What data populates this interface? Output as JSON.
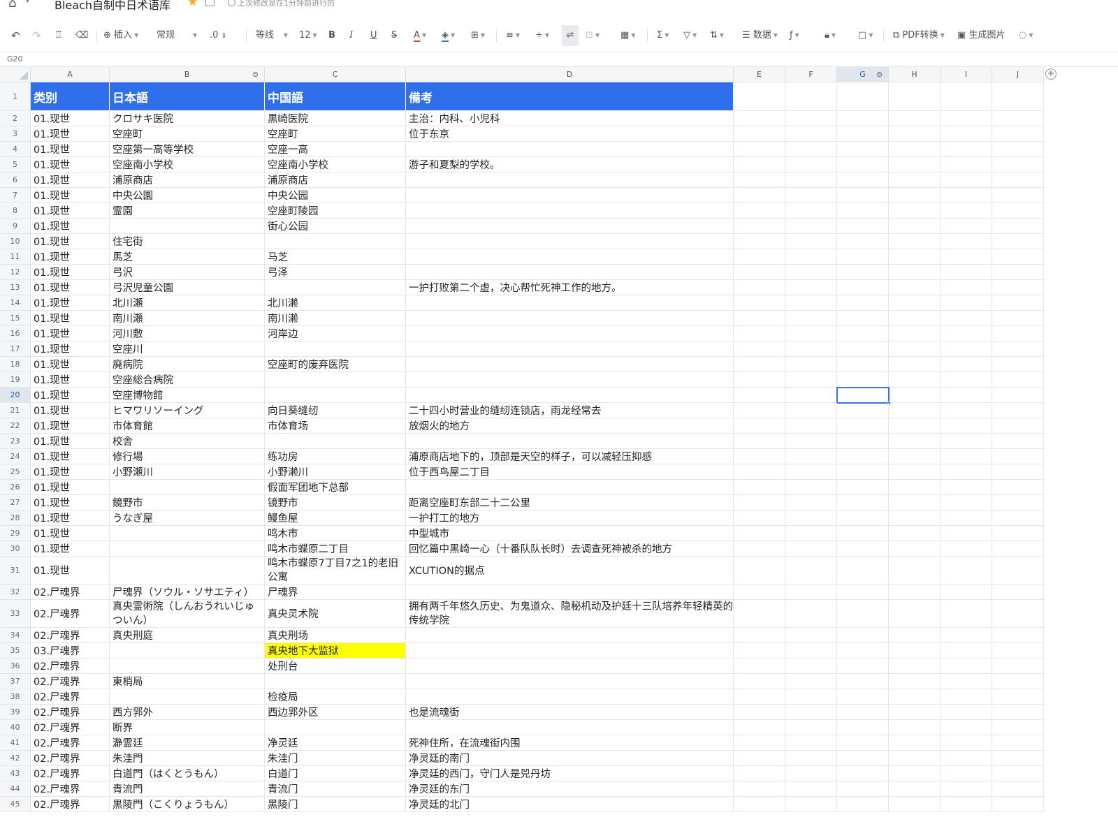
{
  "title_bar": {
    "doc_title": "Bleach自制中日术语库",
    "saved_status": "上次修改是在1分钟前进行的"
  },
  "toolbar": {
    "insert_label": "插入",
    "format_value": "常规",
    "decimal_label": ".0",
    "font_name": "等线",
    "font_size": "12",
    "data_label": "数据",
    "pdf_label": "PDF转换",
    "image_label": "生成图片"
  },
  "formula_bar": {
    "cell_ref": "G20"
  },
  "columns": [
    "A",
    "B",
    "C",
    "D",
    "E",
    "F",
    "G",
    "H",
    "I",
    "J"
  ],
  "selected_column": "G",
  "selected_row": "20",
  "header_row": {
    "num": "1",
    "a": "类别",
    "b": "日本語",
    "c": "中国語",
    "d": "備考"
  },
  "rows": [
    {
      "num": "2",
      "a": "01.现世",
      "b": "クロサキ医院",
      "c": "黒崎医院",
      "d": "主治：内科、小児科"
    },
    {
      "num": "3",
      "a": "01.现世",
      "b": "空座町",
      "c": "空座町",
      "d": "位于东京"
    },
    {
      "num": "4",
      "a": "01.现世",
      "b": "空座第一高等学校",
      "c": "空座一高",
      "d": ""
    },
    {
      "num": "5",
      "a": "01.现世",
      "b": "空座南小学校",
      "c": "空座南小学校",
      "d": "游子和夏梨的学校。"
    },
    {
      "num": "6",
      "a": "01.现世",
      "b": "浦原商店",
      "c": "浦原商店",
      "d": ""
    },
    {
      "num": "7",
      "a": "01.现世",
      "b": "中央公園",
      "c": "中央公园",
      "d": ""
    },
    {
      "num": "8",
      "a": "01.现世",
      "b": "霊園",
      "c": "空座町陵园",
      "d": ""
    },
    {
      "num": "9",
      "a": "01.现世",
      "b": "",
      "c": "街心公园",
      "d": ""
    },
    {
      "num": "10",
      "a": "01.现世",
      "b": "住宅街",
      "c": "",
      "d": ""
    },
    {
      "num": "11",
      "a": "01.现世",
      "b": "馬芝",
      "c": "马芝",
      "d": ""
    },
    {
      "num": "12",
      "a": "01.现世",
      "b": "弓沢",
      "c": "弓泽",
      "d": ""
    },
    {
      "num": "13",
      "a": "01.现世",
      "b": "弓沢児童公園",
      "c": "",
      "d": "一护打败第二个虚，决心帮忙死神工作的地方。"
    },
    {
      "num": "14",
      "a": "01.现世",
      "b": "北川瀬",
      "c": "北川濑",
      "d": ""
    },
    {
      "num": "15",
      "a": "01.现世",
      "b": "南川瀬",
      "c": "南川濑",
      "d": ""
    },
    {
      "num": "16",
      "a": "01.现世",
      "b": "河川敷",
      "c": "河岸边",
      "d": ""
    },
    {
      "num": "17",
      "a": "01.现世",
      "b": "空座川",
      "c": "",
      "d": ""
    },
    {
      "num": "18",
      "a": "01.现世",
      "b": "廃病院",
      "c": "空座町的废弃医院",
      "d": ""
    },
    {
      "num": "19",
      "a": "01.现世",
      "b": "空座総合病院",
      "c": "",
      "d": ""
    },
    {
      "num": "20",
      "a": "01.现世",
      "b": "空座博物館",
      "c": "",
      "d": ""
    },
    {
      "num": "21",
      "a": "01.现世",
      "b": "ヒマワリソーイング",
      "c": "向日葵缝纫",
      "d": "二十四小时营业的缝纫连锁店，雨龙经常去"
    },
    {
      "num": "22",
      "a": "01.现世",
      "b": "市体育館",
      "c": "市体育场",
      "d": "放烟火的地方"
    },
    {
      "num": "23",
      "a": "01.现世",
      "b": "校舎",
      "c": "",
      "d": ""
    },
    {
      "num": "24",
      "a": "01.现世",
      "b": "修行場",
      "c": "练功房",
      "d": "浦原商店地下的，顶部是天空的样子，可以减轻压抑感"
    },
    {
      "num": "25",
      "a": "01.现世",
      "b": "小野瀬川",
      "c": "小野濑川",
      "d": "位于西鸟屋二丁目"
    },
    {
      "num": "26",
      "a": "01.现世",
      "b": "",
      "c": "假面军团地下总部",
      "d": ""
    },
    {
      "num": "27",
      "a": "01.现世",
      "b": "鏡野市",
      "c": "镜野市",
      "d": "距离空座町东部二十二公里"
    },
    {
      "num": "28",
      "a": "01.现世",
      "b": "うなぎ屋",
      "c": "鳗鱼屋",
      "d": "一护打工的地方"
    },
    {
      "num": "29",
      "a": "01.现世",
      "b": "",
      "c": "鸣木市",
      "d": "中型城市"
    },
    {
      "num": "30",
      "a": "01.现世",
      "b": "",
      "c": "鸣木市蝶原二丁目",
      "d": "回忆篇中黑崎一心（十番队队长时）去调查死神被杀的地方"
    },
    {
      "num": "31",
      "a": "01.现世",
      "b": "",
      "c": "鸣木市蝶原7丁目7之1的老旧公寓",
      "d": "XCUTION的据点"
    },
    {
      "num": "32",
      "a": "02.尸魂界",
      "b": "尸魂界（ソウル・ソサエティ）",
      "c": "尸魂界",
      "d": ""
    },
    {
      "num": "33",
      "a": "02.尸魂界",
      "b": "真央霊術院（しんおうれいじゅついん）",
      "c": "真央灵术院",
      "d": "拥有两千年悠久历史、为鬼道众、隐秘机动及护廷十三队培养年轻精英的传统学院"
    },
    {
      "num": "34",
      "a": "02.尸魂界",
      "b": "真央刑庭",
      "c": "真央刑场",
      "d": ""
    },
    {
      "num": "35",
      "a": "03.尸魂界",
      "b": "",
      "c": "真央地下大监狱",
      "d": ""
    },
    {
      "num": "36",
      "a": "02.尸魂界",
      "b": "",
      "c": "处刑台",
      "d": ""
    },
    {
      "num": "37",
      "a": "02.尸魂界",
      "b": "東梢局",
      "c": "",
      "d": ""
    },
    {
      "num": "38",
      "a": "02.尸魂界",
      "b": "",
      "c": "检疫局",
      "d": ""
    },
    {
      "num": "39",
      "a": "02.尸魂界",
      "b": "西方郛外",
      "c": "西边郛外区",
      "d": "也是流魂街"
    },
    {
      "num": "40",
      "a": "02.尸魂界",
      "b": "断界",
      "c": "",
      "d": ""
    },
    {
      "num": "41",
      "a": "02.尸魂界",
      "b": "瀞霊廷",
      "c": "净灵廷",
      "d": "死神住所，在流魂街内围"
    },
    {
      "num": "42",
      "a": "02.尸魂界",
      "b": "朱洼門",
      "c": "朱洼门",
      "d": "净灵廷的南门"
    },
    {
      "num": "43",
      "a": "02.尸魂界",
      "b": "白道門（はくとうもん）",
      "c": "白道门",
      "d": "净灵廷的西门，守门人是兕丹坊"
    },
    {
      "num": "44",
      "a": "02.尸魂界",
      "b": "青流門",
      "c": "青流门",
      "d": "净灵廷的东门"
    },
    {
      "num": "45",
      "a": "02.尸魂界",
      "b": "黒陵門（こくりょうもん）",
      "c": "黑陵门",
      "d": "净灵廷的北门"
    }
  ],
  "colors": {
    "header_fill": "#2f6fec",
    "highlight_fill": "#ffff00",
    "selection": "#3370ff"
  }
}
